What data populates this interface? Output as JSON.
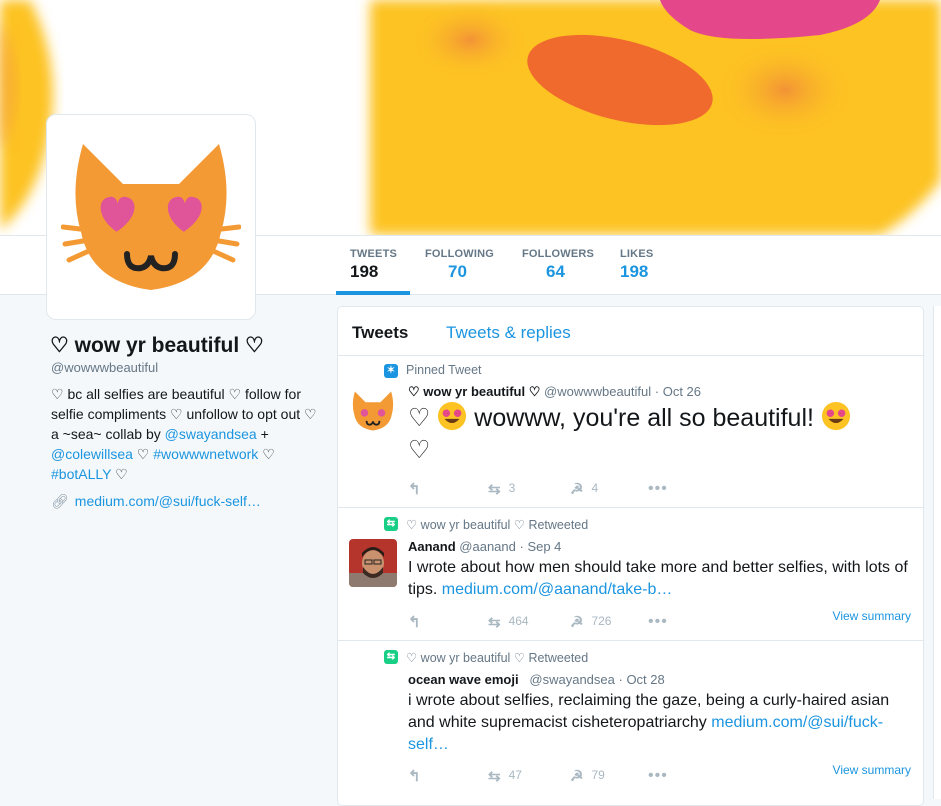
{
  "colors": {
    "accent": "#1b95e0",
    "retweet": "#19cf86",
    "header_yellow": "#fdc323",
    "cat_orange": "#f39a34"
  },
  "profile": {
    "name": "♡ wow yr beautiful ♡",
    "handle": "@wowwwbeautiful",
    "bio_parts": {
      "p1": "♡ bc all selfies are beautiful ♡ follow for selfie compliments ♡ unfollow to opt out ♡ a ~sea~ collab by ",
      "m1": "@swayandsea",
      "p2": " + ",
      "m2": "@colewillsea",
      "p3": " ♡ ",
      "h1": "#wowwwnetwork",
      "p4": " ♡ ",
      "h2": "#botALLY",
      "p5": " ♡"
    },
    "link": "medium.com/@sui/fuck-self…",
    "link_icon": "link-icon"
  },
  "stats": [
    {
      "label": "TWEETS",
      "value": "198"
    },
    {
      "label": "FOLLOWING",
      "value": "70"
    },
    {
      "label": "FOLLOWERS",
      "value": "64"
    },
    {
      "label": "LIKES",
      "value": "198"
    }
  ],
  "tabs": {
    "tweets": "Tweets",
    "replies": "Tweets & replies"
  },
  "tweets": [
    {
      "context": "Pinned Tweet",
      "context_icon": "pin-icon",
      "name": "♡ wow yr beautiful ♡",
      "handle": "@wowwwbeautiful",
      "date": "· Oct 26",
      "text_a": "♡ ",
      "text_b": " wowww, you're all so beautiful! ",
      "text_c": "♡",
      "retweets": "3",
      "likes": "4"
    },
    {
      "context": "♡ wow yr beautiful ♡ Retweeted",
      "context_icon": "retweet-icon",
      "name": "Aanand",
      "handle": "@aanand",
      "date": "· Sep 4",
      "text": "I wrote about how men should take more and better selfies, with lots of tips. ",
      "link": "medium.com/@aanand/take-b…",
      "retweets": "464",
      "likes": "726",
      "view_summary": "View summary"
    },
    {
      "context": "♡ wow yr beautiful ♡ Retweeted",
      "context_icon": "retweet-icon",
      "name": "ocean wave emoji",
      "handle": "@swayandsea",
      "date": "· Oct 28",
      "text": "i wrote about selfies, reclaiming the gaze, being a curly-haired asian and white supremacist cisheteropatriarchy ",
      "link": "medium.com/@sui/fuck-self…",
      "retweets": "47",
      "likes": "79",
      "view_summary": "View summary"
    }
  ]
}
